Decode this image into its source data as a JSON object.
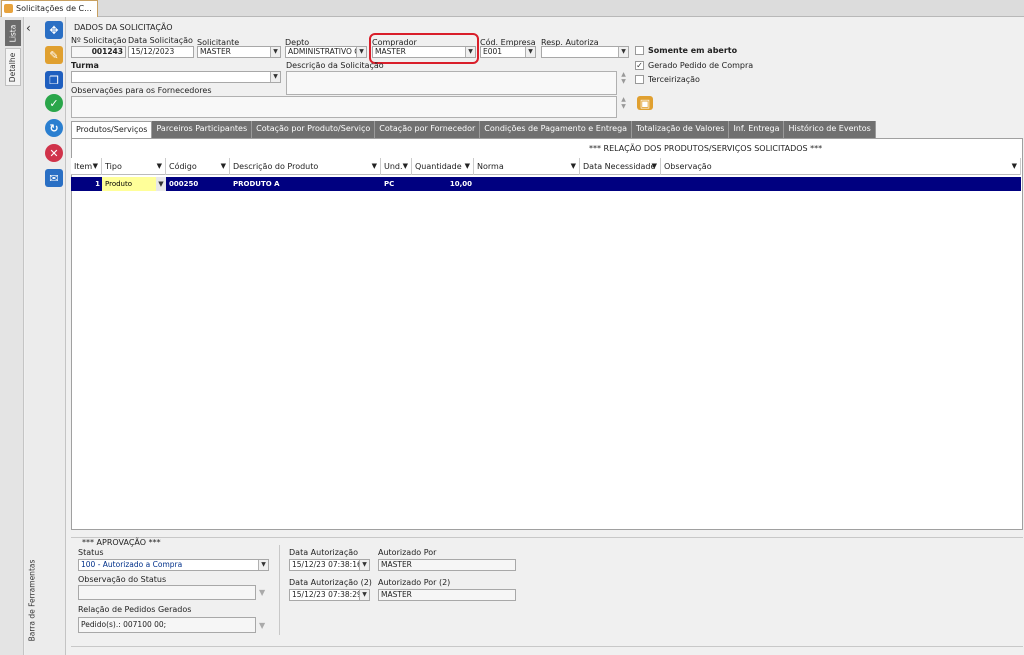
{
  "window": {
    "tab_title": "Solicitações de C..."
  },
  "sidebar": {
    "tab_lista": "Lista",
    "tab_detalhe": "Detalhe",
    "toolbar_label": "Barra de Ferramentas"
  },
  "toolbar": {
    "icons": [
      "expand-icon",
      "edit-icon",
      "copy-icon",
      "check-icon",
      "refresh-icon",
      "cancel-icon",
      "mail-icon"
    ]
  },
  "header": {
    "section_title": "DADOS DA SOLICITAÇÃO",
    "num_label": "Nº Solicitação",
    "num_value": "001243",
    "date_label": "Data Solicitação",
    "date_value": "15/12/2023",
    "solicitante_label": "Solicitante",
    "solicitante_value": "MASTER",
    "depto_label": "Depto",
    "depto_value": "ADMINISTRATIVO G",
    "comprador_label": "Comprador",
    "comprador_value": "MASTER",
    "empresa_label": "Cód. Empresa",
    "empresa_value": "E001",
    "resp_label": "Resp. Autoriza",
    "resp_value": "",
    "turma_label": "Turma",
    "turma_value": "",
    "descricao_label": "Descrição da Solicitação",
    "obs_label": "Observações para os Fornecedores",
    "chk_aberto": "Somente em aberto",
    "chk_gerado": "Gerado Pedido de Compra",
    "chk_terceirizacao": "Terceirização"
  },
  "tabs": [
    "Produtos/Serviços",
    "Parceiros Participantes",
    "Cotação por Produto/Serviço",
    "Cotação por Fornecedor",
    "Condições de Pagamento e Entrega",
    "Totalização de Valores",
    "Inf. Entrega",
    "Histórico de Eventos"
  ],
  "grid": {
    "title": "*** RELAÇÃO DOS PRODUTOS/SERVIÇOS SOLICITADOS ***",
    "columns": [
      "Item",
      "Tipo",
      "Código",
      "Descrição do Produto",
      "Und.",
      "Quantidade",
      "Norma",
      "Data Necessidade",
      "Observação"
    ],
    "rows": [
      {
        "item": "1",
        "tipo": "Produto",
        "codigo": "000250",
        "descricao": "PRODUTO A",
        "und": "PC",
        "quantidade": "10,00",
        "norma": "",
        "data": "",
        "obs": ""
      }
    ]
  },
  "approval": {
    "title": "*** APROVAÇÃO ***",
    "status_label": "Status",
    "status_value": "100 - Autorizado a Compra",
    "obs_status_label": "Observação do Status",
    "pedidos_label": "Relação de Pedidos Gerados",
    "pedidos_value": "Pedido(s).:  007100 00;",
    "data_aut_label": "Data Autorização",
    "data_aut_value": "15/12/23 07:38:16",
    "aut_por_label": "Autorizado Por",
    "aut_por_value": "MASTER",
    "data_aut2_label": "Data Autorização (2)",
    "data_aut2_value": "15/12/23 07:38:29",
    "aut_por2_label": "Autorizado Por (2)",
    "aut_por2_value": "MASTER"
  },
  "colors": {
    "grid_selected": "#000080",
    "highlight": "#d91e2a",
    "tab_inactive": "#707070"
  }
}
